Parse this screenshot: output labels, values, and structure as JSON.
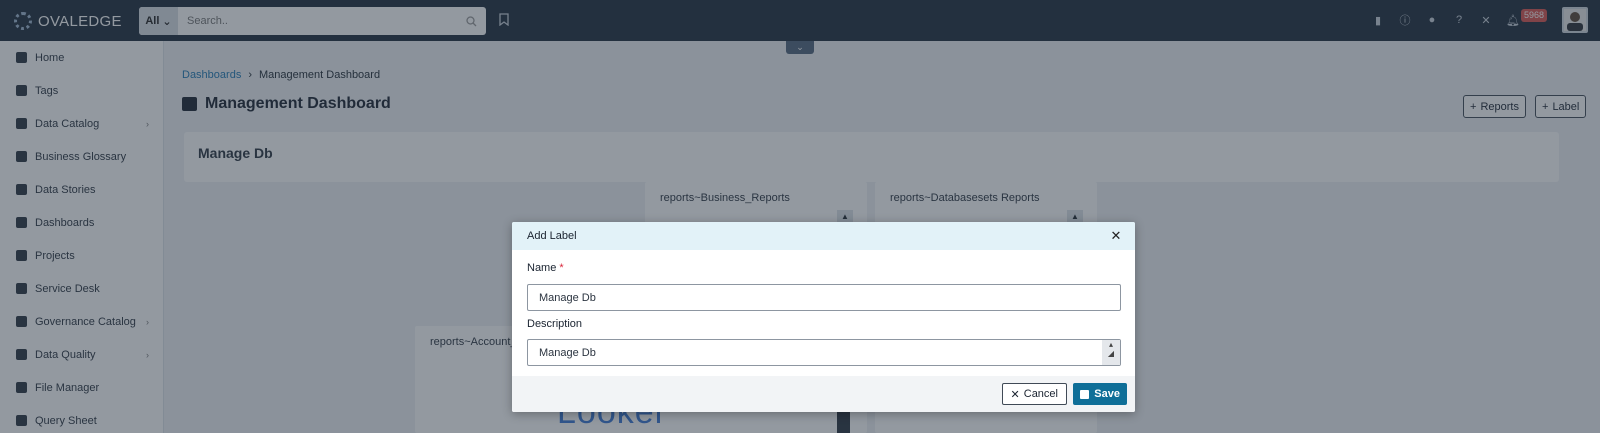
{
  "app": {
    "logo_text": "OVALEDGE"
  },
  "search": {
    "scope": "All",
    "placeholder": "Search.."
  },
  "notifications": {
    "count": "5968"
  },
  "sidebar": {
    "items": [
      {
        "label": "Home",
        "icon": "home-icon",
        "expandable": false
      },
      {
        "label": "Tags",
        "icon": "tag-icon",
        "expandable": false
      },
      {
        "label": "Data Catalog",
        "icon": "catalog-icon",
        "expandable": true
      },
      {
        "label": "Business Glossary",
        "icon": "book-icon",
        "expandable": false
      },
      {
        "label": "Data Stories",
        "icon": "stories-icon",
        "expandable": false
      },
      {
        "label": "Dashboards",
        "icon": "dashboard-icon",
        "expandable": false
      },
      {
        "label": "Projects",
        "icon": "clipboard-icon",
        "expandable": false
      },
      {
        "label": "Service Desk",
        "icon": "service-desk-icon",
        "expandable": false
      },
      {
        "label": "Governance Catalog",
        "icon": "governance-icon",
        "expandable": true
      },
      {
        "label": "Data Quality",
        "icon": "data-quality-icon",
        "expandable": true
      },
      {
        "label": "File Manager",
        "icon": "folder-icon",
        "expandable": false
      },
      {
        "label": "Query Sheet",
        "icon": "query-icon",
        "expandable": false
      }
    ]
  },
  "breadcrumb": {
    "parent": "Dashboards",
    "current": "Management Dashboard"
  },
  "page": {
    "title": "Management Dashboard",
    "reports_button": "Reports",
    "label_button": "Label",
    "dashboard_label": "Manage Db"
  },
  "cards": [
    {
      "title": "reports~Business_Reports"
    },
    {
      "title": "reports~Databasesets Reports"
    },
    {
      "title": "reports~Account_R"
    }
  ],
  "looker_logo_text": "Looker",
  "modal": {
    "title": "Add Label",
    "name_label": "Name",
    "required_mark": "*",
    "name_value": "Manage Db",
    "description_label": "Description",
    "description_value": "Manage Db",
    "cancel_label": "Cancel",
    "save_label": "Save"
  },
  "colors": {
    "topbar": "#1f2d3d",
    "accent": "#0f6f98",
    "modal_header": "#e2f2f8",
    "badge": "#d9534f"
  }
}
